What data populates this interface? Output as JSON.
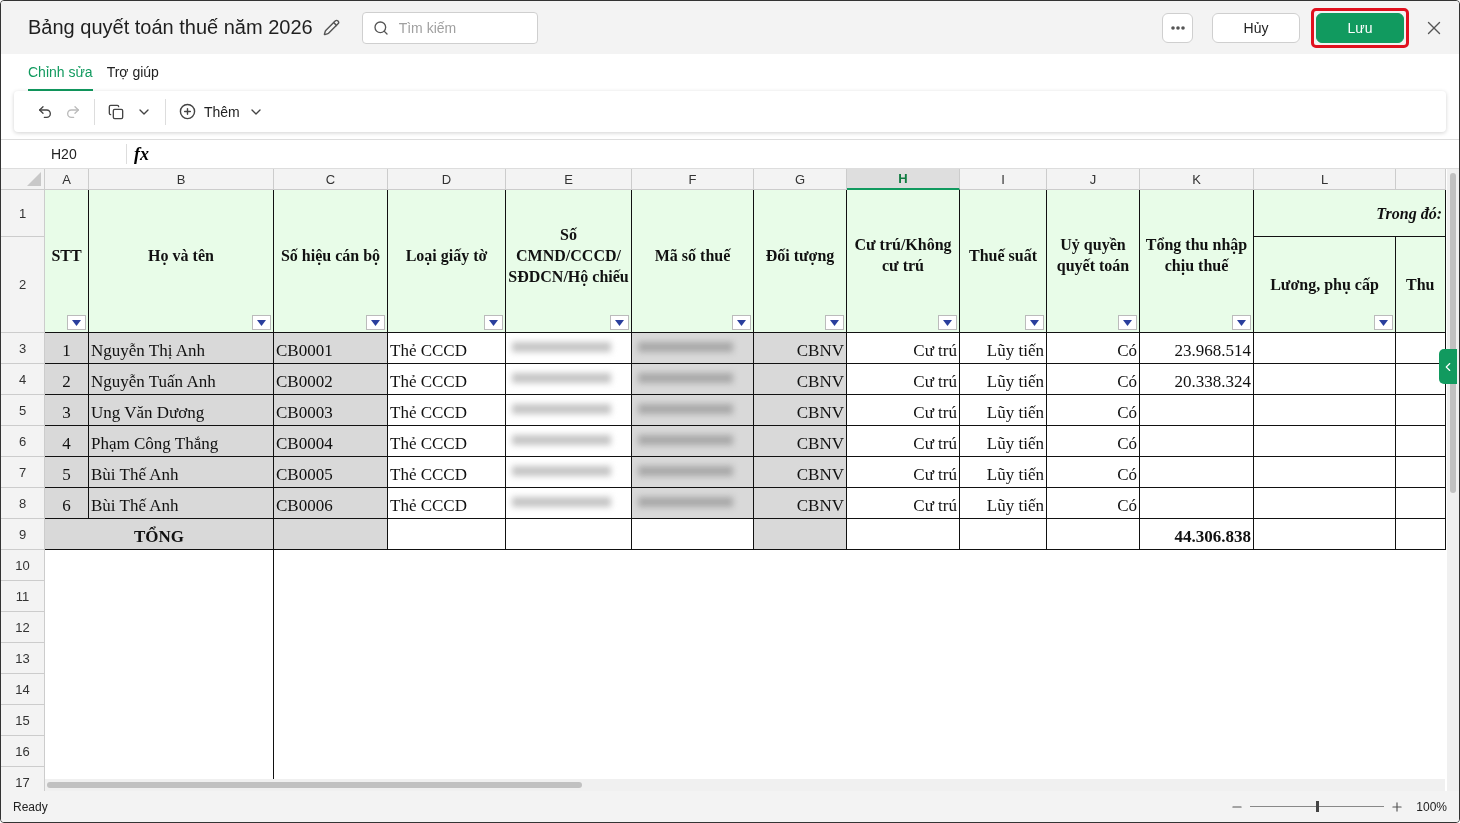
{
  "title": "Bảng quyết toán thuế năm 2026",
  "search": {
    "placeholder": "Tìm kiếm"
  },
  "buttons": [
    {
      "label": "Hủy",
      "kind": "secondary",
      "highlighted": false
    },
    {
      "label": "Lưu",
      "kind": "primary",
      "highlighted": true
    }
  ],
  "tabs": [
    {
      "label": "Chỉnh sửa",
      "selected": true
    },
    {
      "label": "Trợ giúp",
      "selected": false
    }
  ],
  "toolbar": {
    "undo": {
      "disabled": false
    },
    "redo": {
      "disabled": true
    },
    "add_label": "Thêm"
  },
  "formula_bar": {
    "cell_ref": "H20",
    "fx": "fx"
  },
  "sheet": {
    "columns": [
      {
        "label": "A",
        "selected": false
      },
      {
        "label": "B",
        "selected": false
      },
      {
        "label": "C",
        "selected": false
      },
      {
        "label": "D",
        "selected": false
      },
      {
        "label": "E",
        "selected": false
      },
      {
        "label": "F",
        "selected": false
      },
      {
        "label": "G",
        "selected": false
      },
      {
        "label": "H",
        "selected": true
      },
      {
        "label": "I",
        "selected": false
      },
      {
        "label": "J",
        "selected": false
      },
      {
        "label": "K",
        "selected": false
      },
      {
        "label": "L",
        "selected": false
      }
    ],
    "row_numbers": [
      "1",
      "2",
      "3",
      "4",
      "5",
      "6",
      "7",
      "8",
      "9",
      "10",
      "11",
      "12",
      "13",
      "14",
      "15",
      "16",
      "17"
    ],
    "headers": [
      {
        "text": "STT",
        "filter": true
      },
      {
        "text": "Họ và tên",
        "filter": true
      },
      {
        "text": "Số hiệu cán bộ",
        "filter": true
      },
      {
        "text": "Loại giấy tờ",
        "filter": true
      },
      {
        "text": "Số CMND/CCCD/ SĐDCN/Hộ chiếu",
        "filter": true
      },
      {
        "text": "Mã số thuế",
        "filter": true
      },
      {
        "text": "Đối tượng",
        "filter": true
      },
      {
        "text": "Cư trú/Không cư trú",
        "filter": true
      },
      {
        "text": "Thuế suất",
        "filter": true
      },
      {
        "text": "Uỷ quyền quyết toán",
        "filter": true
      },
      {
        "text": "Tổng thu nhập chịu thuế",
        "filter": true
      }
    ],
    "group_header": "Trong đó:",
    "sub_headers": [
      {
        "text": "Lương, phụ cấp",
        "filter": true
      },
      {
        "text": "Thu",
        "filter": false
      }
    ],
    "rows": [
      {
        "stt": "1",
        "name": "Nguyễn Thị Anh",
        "code": "CB0001",
        "doc_type": "Thẻ CCCD",
        "object": "CBNV",
        "residency": "Cư trú",
        "tax_rate": "Lũy tiến",
        "authorized": "Có",
        "total_income": "23.968.514"
      },
      {
        "stt": "2",
        "name": "Nguyễn Tuấn Anh",
        "code": "CB0002",
        "doc_type": "Thẻ CCCD",
        "object": "CBNV",
        "residency": "Cư trú",
        "tax_rate": "Lũy tiến",
        "authorized": "Có",
        "total_income": "20.338.324"
      },
      {
        "stt": "3",
        "name": "Ung Văn Dương",
        "code": "CB0003",
        "doc_type": "Thẻ CCCD",
        "object": "CBNV",
        "residency": "Cư trú",
        "tax_rate": "Lũy tiến",
        "authorized": "Có"
      },
      {
        "stt": "4",
        "name": "Phạm Công Thắng",
        "code": "CB0004",
        "doc_type": "Thẻ CCCD",
        "object": "CBNV",
        "residency": "Cư trú",
        "tax_rate": "Lũy tiến",
        "authorized": "Có"
      },
      {
        "stt": "5",
        "name": "Bùi Thế Anh",
        "code": "CB0005",
        "doc_type": "Thẻ CCCD",
        "object": "CBNV",
        "residency": "Cư trú",
        "tax_rate": "Lũy tiến",
        "authorized": "Có"
      },
      {
        "stt": "6",
        "name": "Bùi Thế Anh",
        "code": "CB0006",
        "doc_type": "Thẻ CCCD",
        "object": "CBNV",
        "residency": "Cư trú",
        "tax_rate": "Lũy tiến",
        "authorized": "Có"
      }
    ],
    "total": {
      "label": "TỔNG",
      "total_income": "44.306.838"
    }
  },
  "status_bar": {
    "status": "Ready",
    "zoom": "100%",
    "level": 0.5
  }
}
